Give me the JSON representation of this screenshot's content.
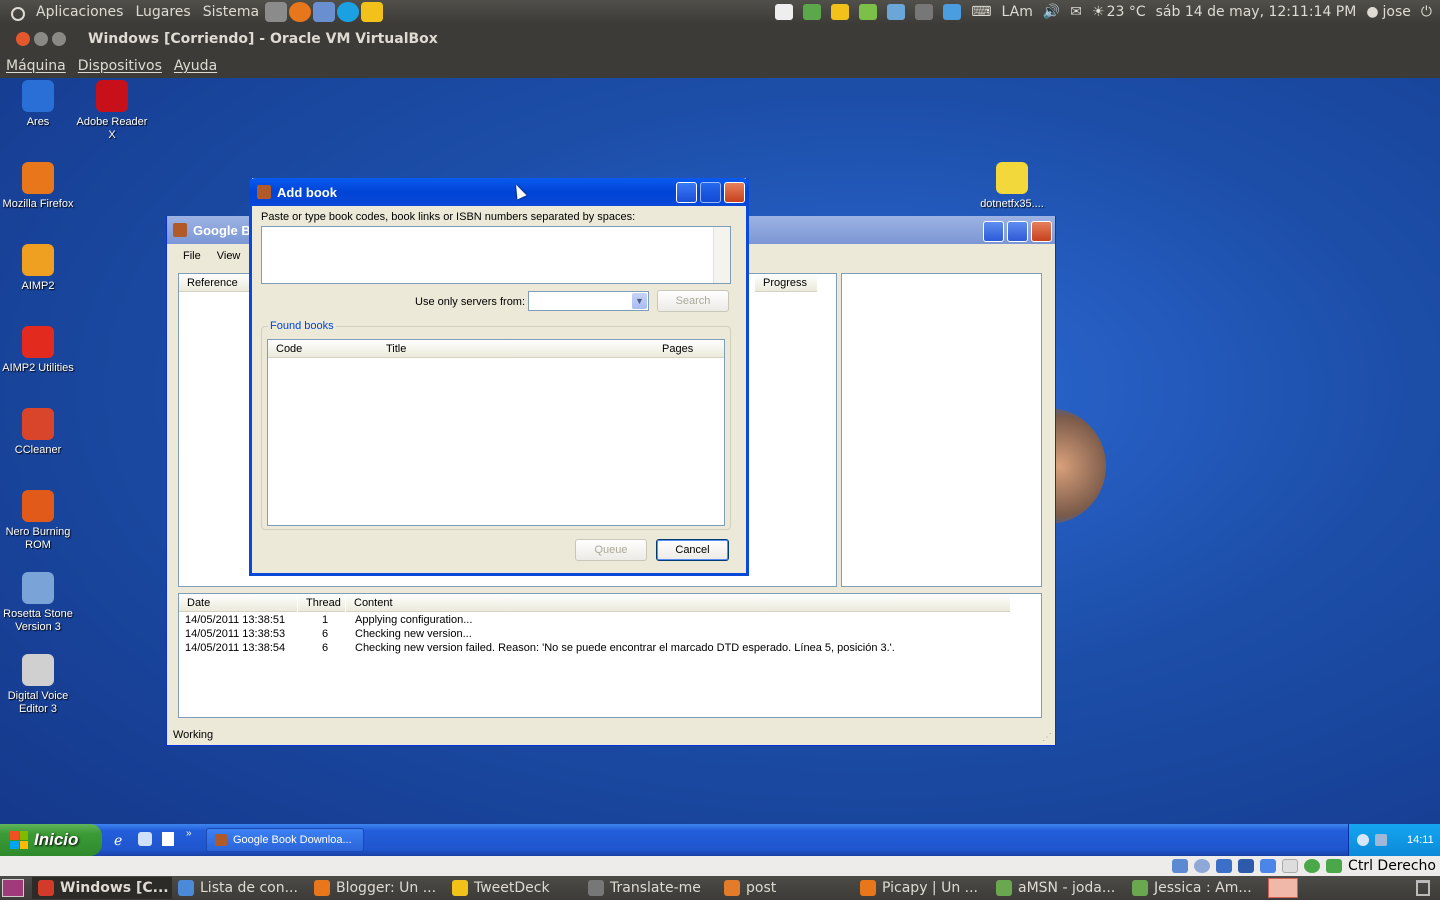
{
  "top_panel": {
    "menus": [
      "Aplicaciones",
      "Lugares",
      "Sistema"
    ],
    "keyboard": "LAm",
    "weather": "23 °C",
    "datetime": "sáb 14 de may, 12:11:14 PM",
    "user": "jose"
  },
  "vbox": {
    "title": "Windows [Corriendo] - Oracle VM VirtualBox",
    "menus": [
      "Máquina",
      "Dispositivos",
      "Ayuda"
    ],
    "status_hostkey": "Ctrl Derecho"
  },
  "desktop_icons": [
    {
      "label": "Ares",
      "color": "#2a6fd6"
    },
    {
      "label": "Adobe Reader X",
      "color": "#c8101a"
    },
    {
      "label": "Mozilla Firefox",
      "color": "#e8771b"
    },
    {
      "label": "AIMP2",
      "color": "#f0a020"
    },
    {
      "label": "AIMP2 Utilities",
      "color": "#e22b1e"
    },
    {
      "label": "CCleaner",
      "color": "#d9452b"
    },
    {
      "label": "Nero Burning ROM",
      "color": "#e25a1a"
    },
    {
      "label": "Rosetta Stone Version 3",
      "color": "#7aa3d8"
    },
    {
      "label": "Digital Voice Editor 3",
      "color": "#d0d0d0"
    },
    {
      "label": "dotnetfx35....",
      "color": "#f2d83a"
    }
  ],
  "google_book_window": {
    "title": "Google Bo",
    "menus": [
      "File",
      "View"
    ],
    "columns": {
      "reference": "Reference",
      "progress": "Progress"
    },
    "log": {
      "headers": {
        "date": "Date",
        "thread": "Thread",
        "content": "Content"
      },
      "rows": [
        {
          "date": "14/05/2011 13:38:51",
          "thread": "1",
          "content": "Applying configuration..."
        },
        {
          "date": "14/05/2011 13:38:53",
          "thread": "6",
          "content": "Checking new version..."
        },
        {
          "date": "14/05/2011 13:38:54",
          "thread": "6",
          "content": "Checking new version failed. Reason: 'No se puede encontrar el marcado DTD esperado. Línea 5, posición 3.'."
        }
      ]
    },
    "status": "Working"
  },
  "add_book_dialog": {
    "title": "Add book",
    "instructions": "Paste or type book codes, book links or ISBN numbers separated by spaces:",
    "codes_value": "",
    "servers_label": "Use only servers from:",
    "servers_selected": "",
    "search_button": "Search",
    "found_books_label": "Found books",
    "columns": {
      "code": "Code",
      "title": "Title",
      "pages": "Pages"
    },
    "queue_button": "Queue",
    "cancel_button": "Cancel"
  },
  "xp_taskbar": {
    "start": "Inicio",
    "task": "Google Book Downloa...",
    "clock": "14:11"
  },
  "bottom_tasks": [
    {
      "label": "Windows [C...",
      "color": "#d23b2a"
    },
    {
      "label": "Lista de con...",
      "color": "#4a8ad8"
    },
    {
      "label": "Blogger: Un ...",
      "color": "#e8771b"
    },
    {
      "label": "TweetDeck",
      "color": "#f2c21a"
    },
    {
      "label": "Translate-me",
      "color": "#777777"
    },
    {
      "label": "post",
      "color": "#e27b2a"
    },
    {
      "label": "Picapy | Un ...",
      "color": "#e8771b"
    },
    {
      "label": "aMSN - joda...",
      "color": "#6aa84f"
    },
    {
      "label": "Jessica : Am...",
      "color": "#6aa84f"
    }
  ],
  "colors": {
    "xp_blue": "#245edb",
    "dialog_frame": "#0a48d8",
    "start_green": "#3c9a36"
  }
}
